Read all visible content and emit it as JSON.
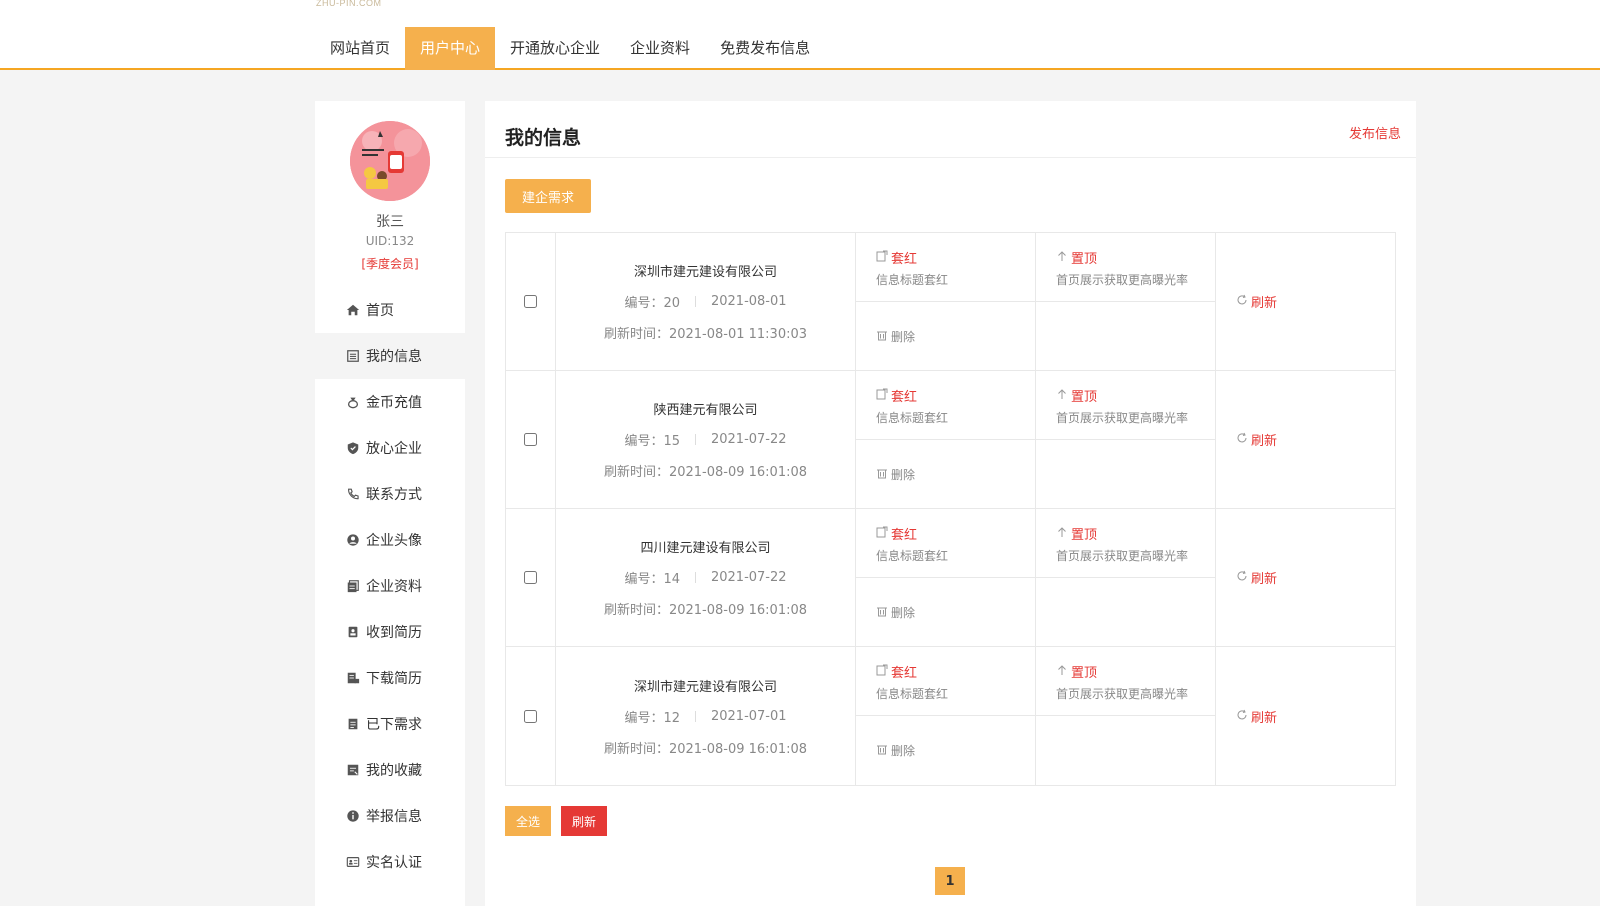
{
  "header": {
    "logo_text": "ZHU-PIN.COM",
    "nav": [
      "网站首页",
      "用户中心",
      "开通放心企业",
      "企业资料",
      "免费发布信息"
    ],
    "active_index": 1
  },
  "user": {
    "name": "张三",
    "uid": "UID:132",
    "level": "[季度会员]"
  },
  "sidebar": {
    "items": [
      {
        "label": "首页",
        "icon": "home-icon"
      },
      {
        "label": "我的信息",
        "icon": "list-icon"
      },
      {
        "label": "金币充值",
        "icon": "money-bag-icon"
      },
      {
        "label": "放心企业",
        "icon": "shield-icon"
      },
      {
        "label": "联系方式",
        "icon": "phone-icon"
      },
      {
        "label": "企业头像",
        "icon": "user-circle-icon"
      },
      {
        "label": "企业资料",
        "icon": "documents-icon"
      },
      {
        "label": "收到简历",
        "icon": "resume-icon"
      },
      {
        "label": "下载简历",
        "icon": "download-resume-icon"
      },
      {
        "label": "已下需求",
        "icon": "order-icon"
      },
      {
        "label": "我的收藏",
        "icon": "bookmark-icon"
      },
      {
        "label": "举报信息",
        "icon": "info-icon"
      },
      {
        "label": "实名认证",
        "icon": "id-card-icon"
      }
    ],
    "active_index": 1
  },
  "main": {
    "title": "我的信息",
    "publish_link": "发布信息",
    "demand_button": "建企需求",
    "rows": [
      {
        "company": "深圳市建元建设有限公司",
        "id_text": "编号：20",
        "date": "2021-08-01",
        "refresh_time": "刷新时间：2021-08-01 11:30:03"
      },
      {
        "company": "陕西建元有限公司",
        "id_text": "编号：15",
        "date": "2021-07-22",
        "refresh_time": "刷新时间：2021-08-09 16:01:08"
      },
      {
        "company": "四川建元建设有限公司",
        "id_text": "编号：14",
        "date": "2021-07-22",
        "refresh_time": "刷新时间：2021-08-09 16:01:08"
      },
      {
        "company": "深圳市建元建设有限公司",
        "id_text": "编号：12",
        "date": "2021-07-01",
        "refresh_time": "刷新时间：2021-08-09 16:01:08"
      }
    ],
    "actions": {
      "red_title": "套红",
      "red_desc": "信息标题套红",
      "top_title": "置顶",
      "top_desc": "首页展示获取更高曝光率",
      "delete": "删除",
      "refresh": "刷新"
    },
    "select_all": "全选",
    "bulk_refresh": "刷新",
    "page": "1"
  },
  "colors": {
    "accent": "#f5b04d",
    "red": "#e53935"
  }
}
